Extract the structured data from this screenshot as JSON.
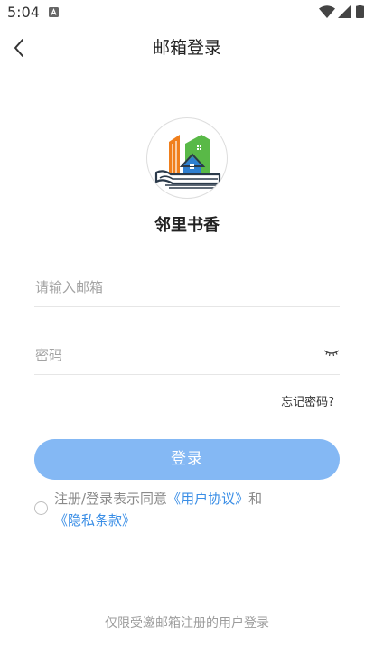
{
  "status_bar": {
    "time": "5:04",
    "icons": [
      "a-notification-icon",
      "wifi-icon",
      "signal-icon",
      "battery-icon"
    ]
  },
  "nav": {
    "title": "邮箱登录",
    "back_icon": "chevron-left-icon"
  },
  "logo": {
    "app_name": "邻里书香",
    "colors": {
      "orange": "#f07f1c",
      "green": "#59b947",
      "blue": "#2f7fd0",
      "dark": "#2b3a4a"
    }
  },
  "form": {
    "email_placeholder": "请输入邮箱",
    "email_value": "",
    "password_placeholder": "密码",
    "password_value": "",
    "eye_icon": "eye-closed-icon",
    "forgot_password": "忘记密码?",
    "login_label": "登录"
  },
  "agreement": {
    "checked": false,
    "text_prefix": "注册/登录表示同意",
    "user_agreement": "《用户协议》",
    "and": "和",
    "privacy_policy": "《隐私条款》"
  },
  "footer": {
    "note": "仅限受邀邮箱注册的用户登录"
  },
  "colors": {
    "primary_button": "#84b8f4",
    "link": "#3a8ee6",
    "placeholder": "#a3a3a3"
  }
}
